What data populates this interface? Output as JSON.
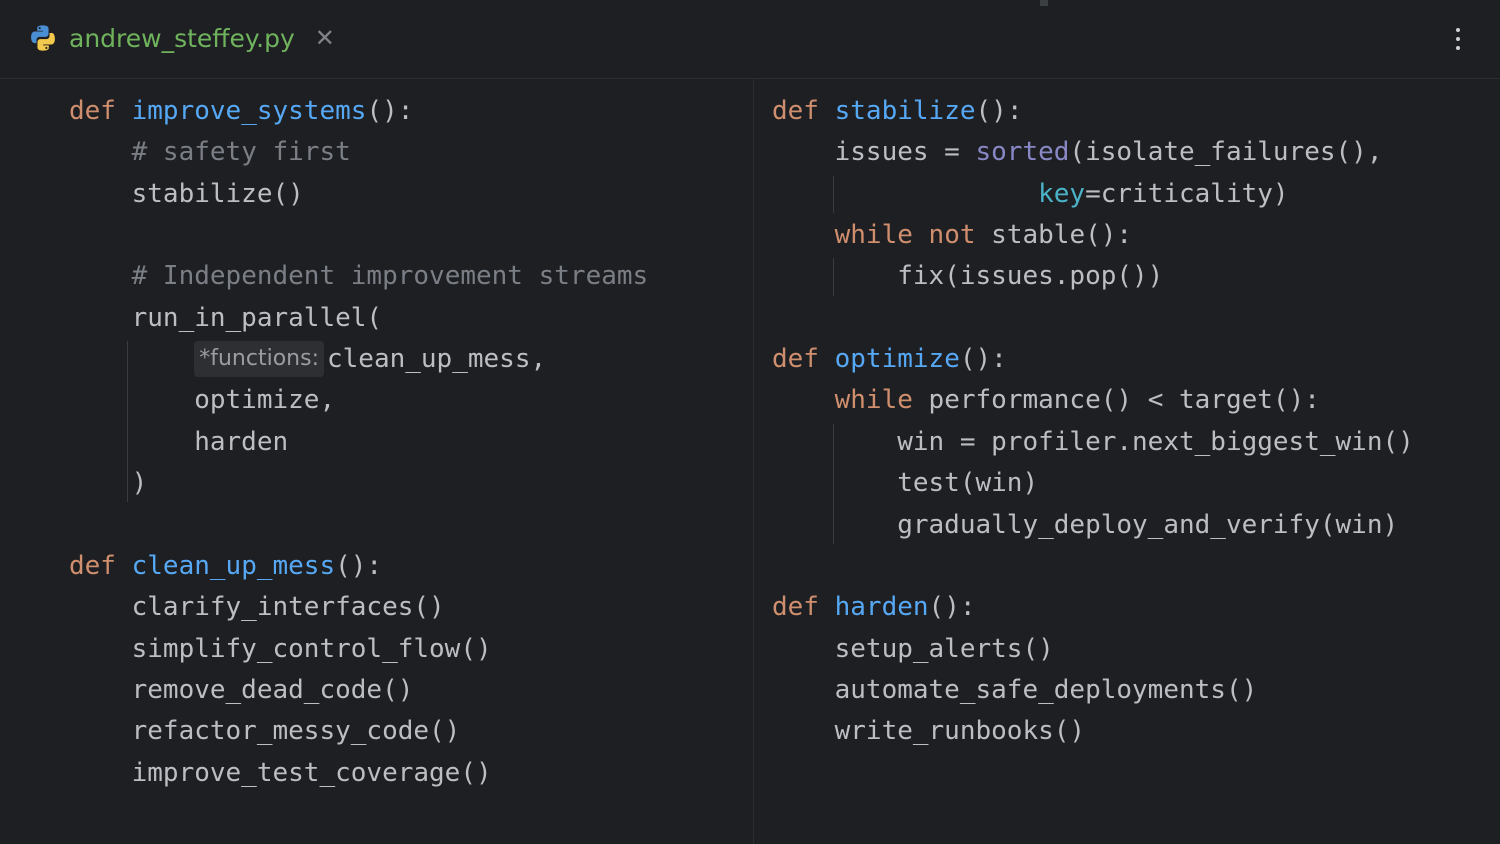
{
  "tab": {
    "filename": "andrew_steffey.py",
    "close_glyph": "✕",
    "icon": "python-icon"
  },
  "menu": {
    "icon": "more-vertical-icon"
  },
  "colors": {
    "keyword": "#cf8e6d",
    "function": "#56a8f5",
    "comment": "#7a7e85",
    "text": "#bcbec4",
    "builtin": "#8888c6",
    "param": "#4ab3c8",
    "filename": "#6fb35c",
    "background": "#1e1f22"
  },
  "left_code": [
    {
      "name": "def-improve-systems",
      "segs": [
        {
          "c": "kw",
          "t": "def "
        },
        {
          "c": "fn",
          "t": "improve_systems"
        },
        {
          "c": "pl",
          "t": "():"
        }
      ]
    },
    {
      "name": "comment-safety-first",
      "segs": [
        {
          "c": "pl",
          "t": "    "
        },
        {
          "c": "cmt",
          "t": "# safety first"
        }
      ]
    },
    {
      "name": "call-stabilize",
      "segs": [
        {
          "c": "pl",
          "t": "    stabilize()"
        }
      ]
    },
    {
      "name": "blank",
      "segs": []
    },
    {
      "name": "comment-independent-streams",
      "segs": [
        {
          "c": "pl",
          "t": "    "
        },
        {
          "c": "cmt",
          "t": "# Independent improvement streams"
        }
      ]
    },
    {
      "name": "call-run-in-parallel",
      "segs": [
        {
          "c": "pl",
          "t": "    run_in_parallel("
        }
      ]
    },
    {
      "name": "arg-clean-up-mess",
      "segs": [
        {
          "c": "pl",
          "t": "        "
        },
        {
          "c": "hint",
          "t": "*functions:"
        },
        {
          "c": "pl",
          "t": "clean_up_mess,"
        }
      ]
    },
    {
      "name": "arg-optimize",
      "segs": [
        {
          "c": "pl",
          "t": "        optimize,"
        }
      ]
    },
    {
      "name": "arg-harden",
      "segs": [
        {
          "c": "pl",
          "t": "        harden"
        }
      ]
    },
    {
      "name": "close-paren",
      "segs": [
        {
          "c": "pl",
          "t": "    )"
        }
      ]
    },
    {
      "name": "blank",
      "segs": []
    },
    {
      "name": "def-clean-up-mess",
      "segs": [
        {
          "c": "kw",
          "t": "def "
        },
        {
          "c": "fn",
          "t": "clean_up_mess"
        },
        {
          "c": "pl",
          "t": "():"
        }
      ]
    },
    {
      "name": "call-clarify-interfaces",
      "segs": [
        {
          "c": "pl",
          "t": "    clarify_interfaces()"
        }
      ]
    },
    {
      "name": "call-simplify-control-flow",
      "segs": [
        {
          "c": "pl",
          "t": "    simplify_control_flow()"
        }
      ]
    },
    {
      "name": "call-remove-dead-code",
      "segs": [
        {
          "c": "pl",
          "t": "    remove_dead_code()"
        }
      ]
    },
    {
      "name": "call-refactor-messy-code",
      "segs": [
        {
          "c": "pl",
          "t": "    refactor_messy_code()"
        }
      ]
    },
    {
      "name": "call-improve-test-coverage",
      "segs": [
        {
          "c": "pl",
          "t": "    improve_test_coverage()"
        }
      ]
    }
  ],
  "right_code": [
    {
      "name": "def-stabilize",
      "segs": [
        {
          "c": "kw",
          "t": "def "
        },
        {
          "c": "fn",
          "t": "stabilize"
        },
        {
          "c": "pl",
          "t": "():"
        }
      ]
    },
    {
      "name": "assign-issues",
      "segs": [
        {
          "c": "pl",
          "t": "    issues = "
        },
        {
          "c": "bi",
          "t": "sorted"
        },
        {
          "c": "pl",
          "t": "(isolate_failures(),"
        }
      ]
    },
    {
      "name": "arg-key-criticality",
      "segs": [
        {
          "c": "pl",
          "t": "                 "
        },
        {
          "c": "pk",
          "t": "key"
        },
        {
          "c": "pl",
          "t": "=criticality)"
        }
      ]
    },
    {
      "name": "while-not-stable",
      "segs": [
        {
          "c": "pl",
          "t": "    "
        },
        {
          "c": "kw",
          "t": "while not "
        },
        {
          "c": "pl",
          "t": "stable():"
        }
      ]
    },
    {
      "name": "call-fix-issues-pop",
      "segs": [
        {
          "c": "pl",
          "t": "        fix(issues.pop())"
        }
      ]
    },
    {
      "name": "blank",
      "segs": []
    },
    {
      "name": "def-optimize",
      "segs": [
        {
          "c": "kw",
          "t": "def "
        },
        {
          "c": "fn",
          "t": "optimize"
        },
        {
          "c": "pl",
          "t": "():"
        }
      ]
    },
    {
      "name": "while-performance-target",
      "segs": [
        {
          "c": "pl",
          "t": "    "
        },
        {
          "c": "kw",
          "t": "while "
        },
        {
          "c": "pl",
          "t": "performance() < target():"
        }
      ]
    },
    {
      "name": "assign-win",
      "segs": [
        {
          "c": "pl",
          "t": "        win = profiler.next_biggest_win()"
        }
      ]
    },
    {
      "name": "call-test-win",
      "segs": [
        {
          "c": "pl",
          "t": "        test(win)"
        }
      ]
    },
    {
      "name": "call-gradually-deploy",
      "segs": [
        {
          "c": "pl",
          "t": "        gradually_deploy_and_verify(win)"
        }
      ]
    },
    {
      "name": "blank",
      "segs": []
    },
    {
      "name": "def-harden",
      "segs": [
        {
          "c": "kw",
          "t": "def "
        },
        {
          "c": "fn",
          "t": "harden"
        },
        {
          "c": "pl",
          "t": "():"
        }
      ]
    },
    {
      "name": "call-setup-alerts",
      "segs": [
        {
          "c": "pl",
          "t": "    setup_alerts()"
        }
      ]
    },
    {
      "name": "call-automate-safe-deployments",
      "segs": [
        {
          "c": "pl",
          "t": "    automate_safe_deployments()"
        }
      ]
    },
    {
      "name": "call-write-runbooks",
      "segs": [
        {
          "c": "pl",
          "t": "    write_runbooks()"
        }
      ]
    }
  ]
}
